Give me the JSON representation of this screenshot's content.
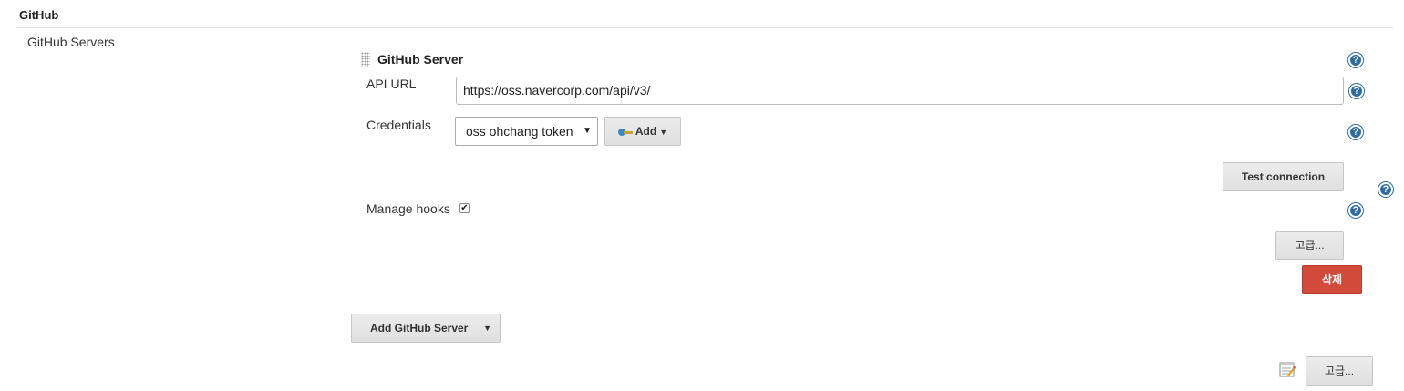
{
  "section": {
    "title": "GitHub",
    "servers_label": "GitHub Servers"
  },
  "server": {
    "heading": "GitHub Server",
    "api_url_label": "API URL",
    "api_url_value": "https://oss.navercorp.com/api/v3/",
    "credentials_label": "Credentials",
    "credentials_selected": "oss ohchang token",
    "add_label": "Add",
    "test_connection_label": "Test connection",
    "manage_hooks_label": "Manage hooks",
    "manage_hooks_checked": true,
    "advanced_label": "고급...",
    "delete_label": "삭제"
  },
  "footer": {
    "add_server_label": "Add GitHub Server",
    "advanced_label": "고급..."
  },
  "icons": {
    "help": "help-icon",
    "key": "key-icon",
    "notepad": "notepad-icon",
    "drag": "drag-handle-icon"
  },
  "colors": {
    "help_blue": "#2e6da4",
    "delete_red": "#d24a3a"
  }
}
